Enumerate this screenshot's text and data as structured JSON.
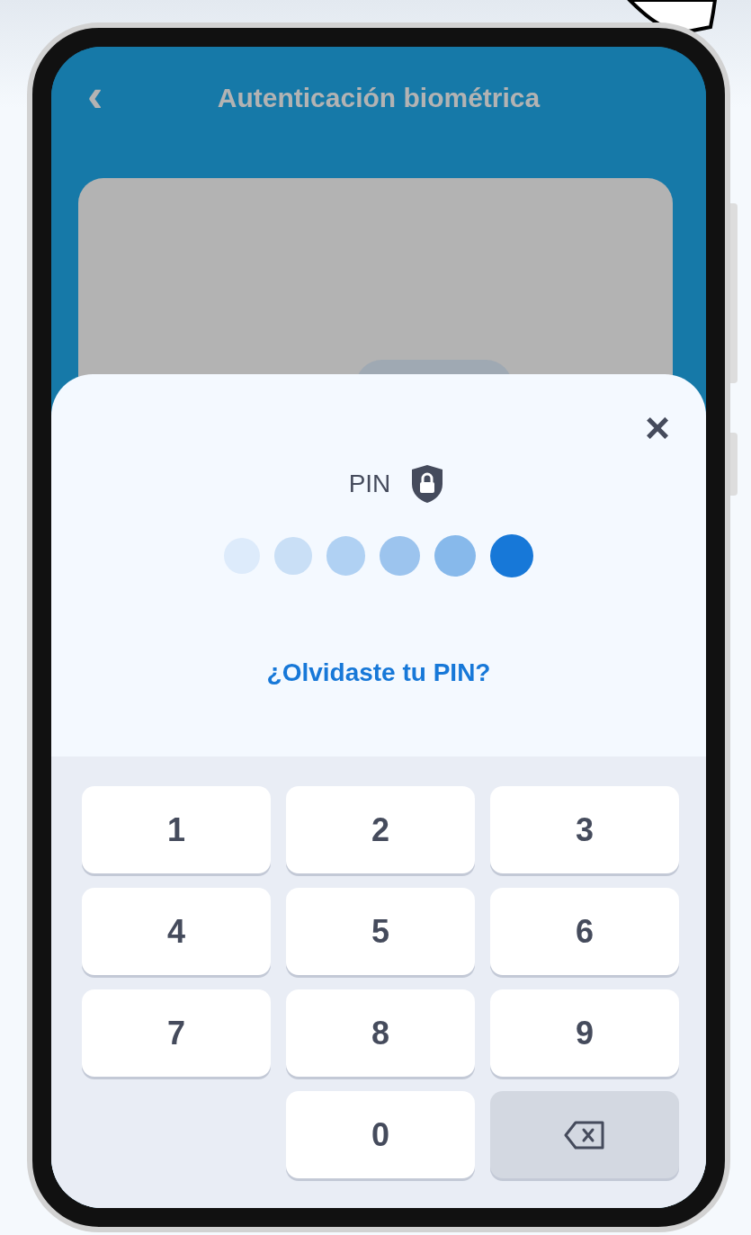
{
  "header": {
    "back_icon": "‹",
    "title": "Autenticación biométrica"
  },
  "pin_sheet": {
    "close": "×",
    "label": "PIN",
    "dots": [
      {
        "color": "#ddebfb"
      },
      {
        "color": "#c9dff6"
      },
      {
        "color": "#b0d1f3"
      },
      {
        "color": "#9cc4ee"
      },
      {
        "color": "#87b9eb"
      },
      {
        "color": "#1778d8"
      }
    ],
    "forgot_link": "¿Olvidaste tu PIN?"
  },
  "keypad": [
    {
      "kind": "digit",
      "label": "1"
    },
    {
      "kind": "digit",
      "label": "2"
    },
    {
      "kind": "digit",
      "label": "3"
    },
    {
      "kind": "digit",
      "label": "4"
    },
    {
      "kind": "digit",
      "label": "5"
    },
    {
      "kind": "digit",
      "label": "6"
    },
    {
      "kind": "digit",
      "label": "7"
    },
    {
      "kind": "digit",
      "label": "8"
    },
    {
      "kind": "digit",
      "label": "9"
    },
    {
      "kind": "blank"
    },
    {
      "kind": "digit",
      "label": "0"
    },
    {
      "kind": "backspace"
    }
  ]
}
